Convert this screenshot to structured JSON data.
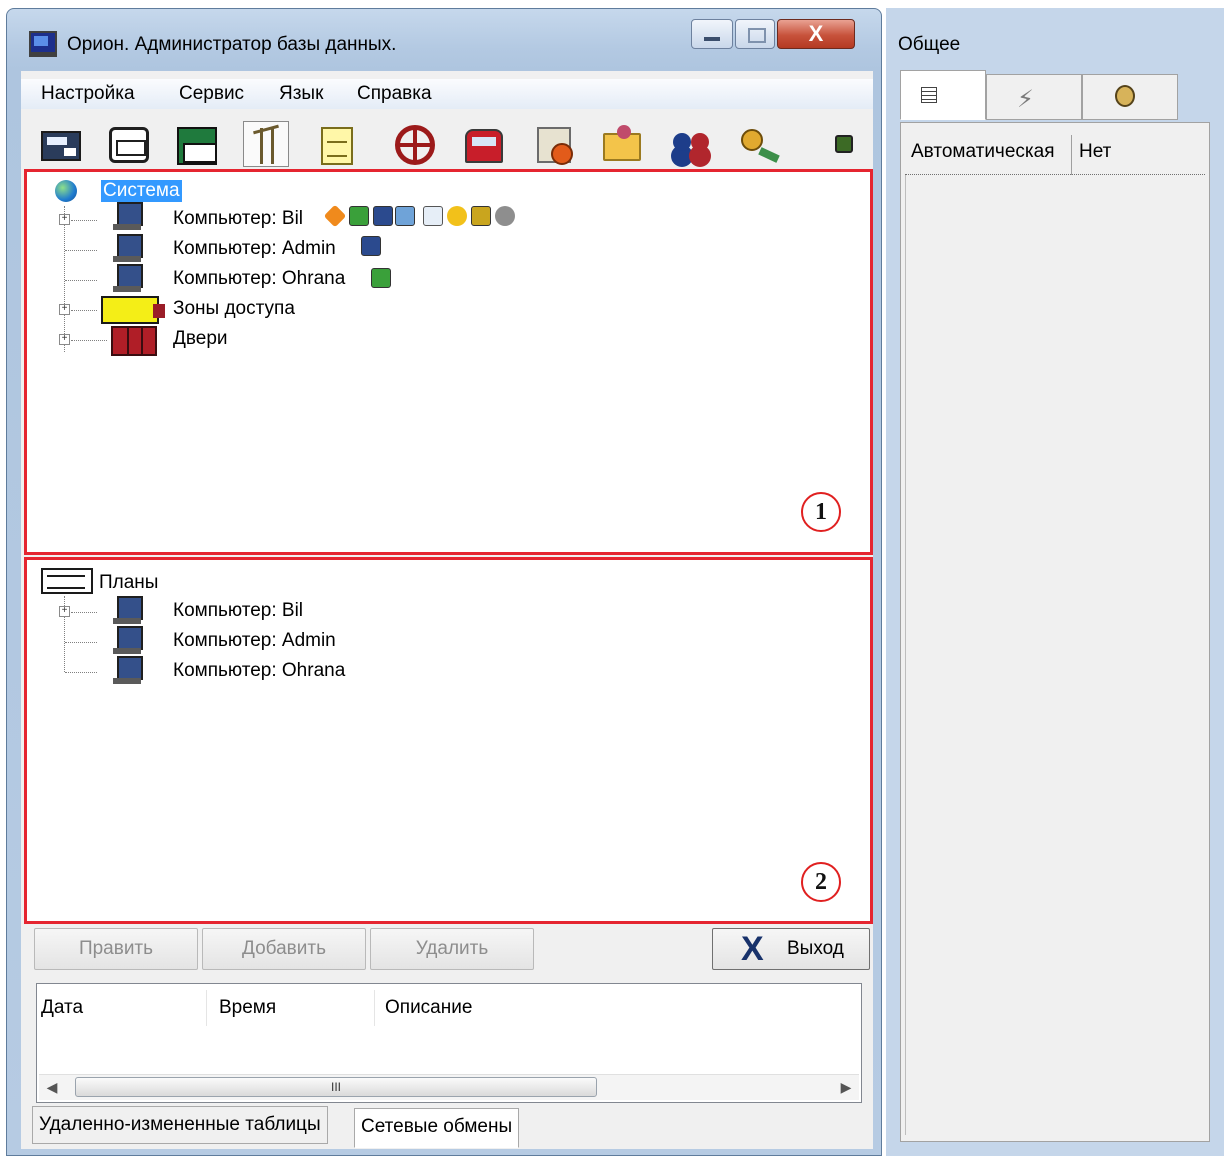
{
  "window": {
    "title": "Орион. Администратор базы данных.",
    "close_glyph": "X"
  },
  "menu": [
    "Настройка",
    "Сервис",
    "Язык",
    "Справка"
  ],
  "toolbar_icons": [
    "computer-icon",
    "board-icon",
    "green-computer-icon",
    "tower-icon",
    "note-icon",
    "wheel-icon",
    "train-clock-icon",
    "clock-icon",
    "folder-user-icon",
    "users-icon",
    "key-icon",
    "bug-icon"
  ],
  "tree1": {
    "root": "Система",
    "items": [
      {
        "label": "Компьютер: Bil",
        "expandable": true
      },
      {
        "label": "Компьютер: Admin",
        "expandable": false
      },
      {
        "label": "Компьютер: Ohrana",
        "expandable": false
      },
      {
        "label": "Зоны доступа",
        "expandable": true
      },
      {
        "label": "Двери",
        "expandable": true
      }
    ],
    "badge": "1"
  },
  "tree2": {
    "root": "Планы",
    "items": [
      {
        "label": "Компьютер: Bil",
        "expandable": true
      },
      {
        "label": "Компьютер: Admin",
        "expandable": false
      },
      {
        "label": "Компьютер: Ohrana",
        "expandable": false
      }
    ],
    "badge": "2"
  },
  "buttons": {
    "edit": "Править",
    "add": "Добавить",
    "delete": "Удалить",
    "exit": "Выход",
    "exit_glyph": "X"
  },
  "log": {
    "columns": [
      "Дата",
      "Время",
      "Описание"
    ],
    "scroll_thumb": "III"
  },
  "bottom_tabs": [
    "Удаленно-измененные таблицы",
    "Сетевые обмены"
  ],
  "right_panel": {
    "title": "Общее",
    "tabs": [
      "list-icon",
      "lightning-icon",
      "person-icon"
    ],
    "bolt_glyph": "⚡",
    "property": {
      "name": "Автоматическая",
      "value": "Нет"
    }
  },
  "colors": {
    "highlight": "#e52530",
    "selection": "#3399ff",
    "frame": "#b6cbe3"
  }
}
